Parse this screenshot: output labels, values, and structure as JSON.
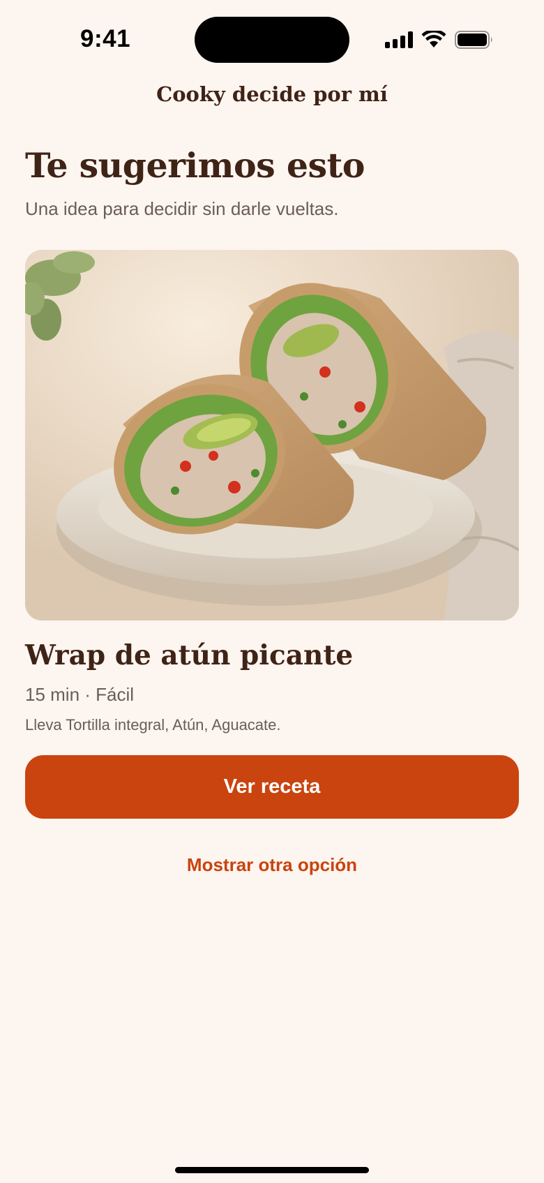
{
  "status_bar": {
    "time": "9:41"
  },
  "nav": {
    "title": "Cooky decide por mí"
  },
  "suggestion": {
    "headline": "Te sugerimos esto",
    "subheadline": "Una idea para decidir sin darle vueltas."
  },
  "recipe": {
    "image_icon": "wrap-photo",
    "title": "Wrap de atún picante",
    "meta": "15 min · Fácil",
    "ingredients": "Lleva Tortilla integral, Atún, Aguacate."
  },
  "actions": {
    "view_recipe_label": "Ver receta",
    "another_option_label": "Mostrar otra opción"
  },
  "colors": {
    "background": "#fdf5f0",
    "accent": "#c9440e",
    "heading": "#3f2317",
    "muted": "#6b5d57"
  }
}
